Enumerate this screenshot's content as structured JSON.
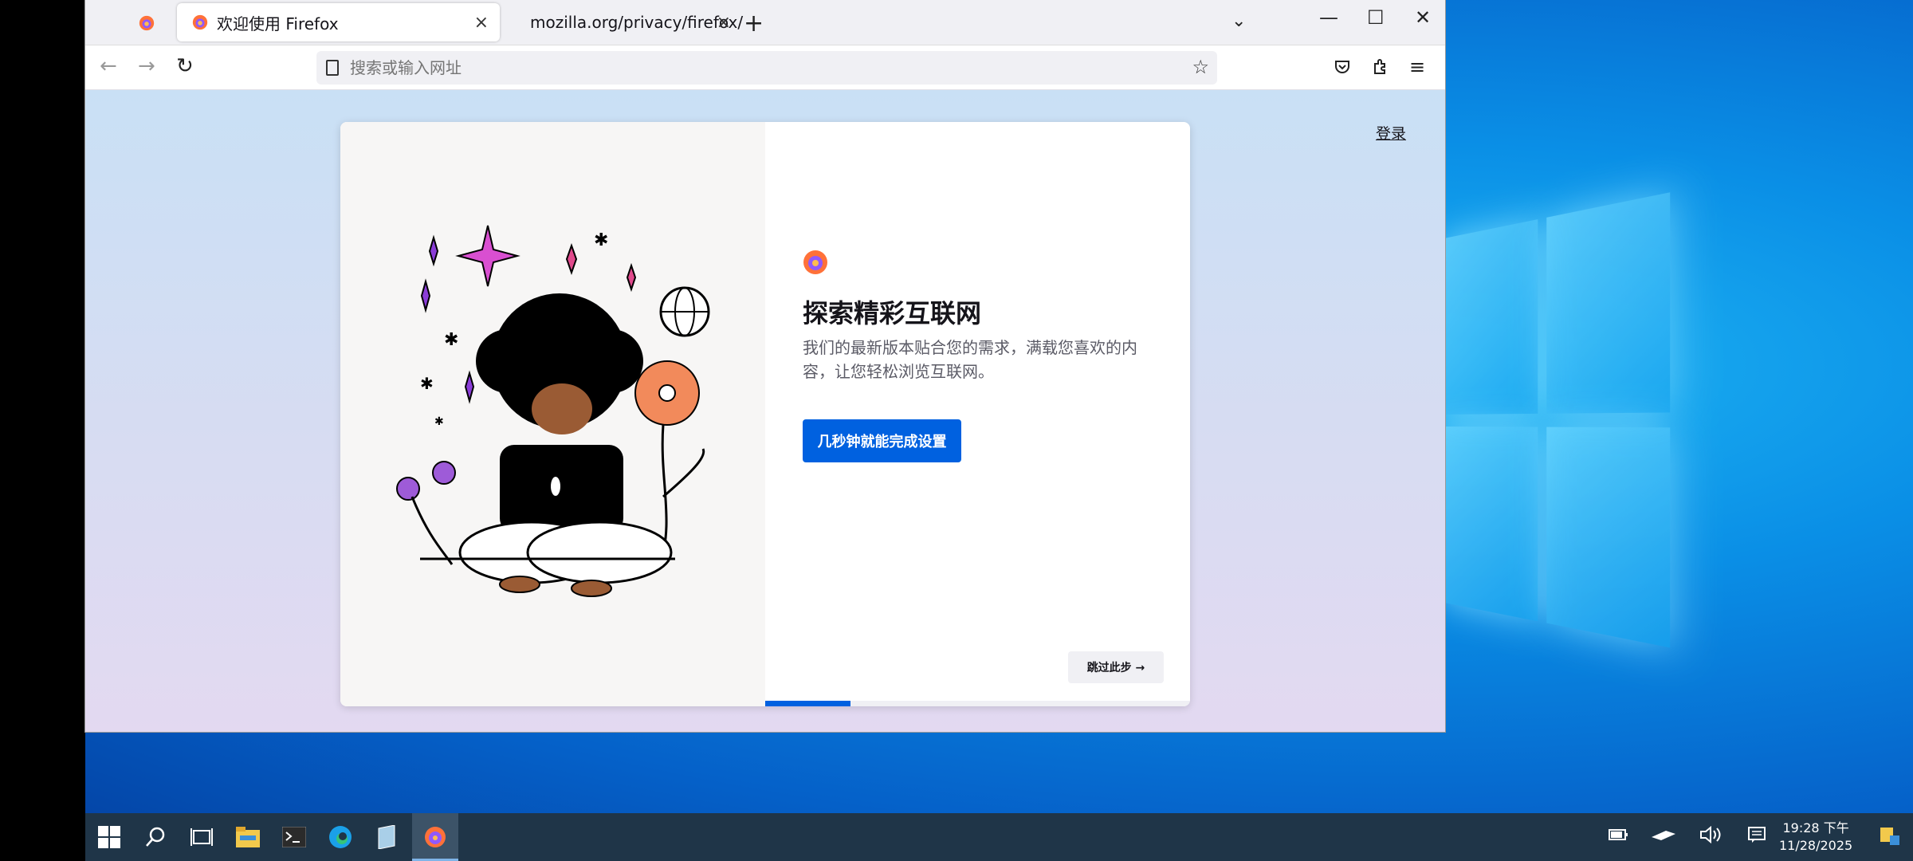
{
  "browser": {
    "tabs": [
      {
        "label": "欢迎使用 Firefox",
        "close": "×"
      },
      {
        "label": "mozilla.org/privacy/firefox/",
        "close": "×"
      }
    ],
    "new_tab": "+",
    "tab_list": "⌄",
    "window_controls": {
      "minimize": "—",
      "maximize": "☐",
      "close": "✕"
    }
  },
  "navbar": {
    "back": "←",
    "forward": "→",
    "reload": "↻",
    "url_placeholder": "搜索或输入网址",
    "bookmark_star": "☆",
    "menu": "≡"
  },
  "page": {
    "signin": "登录",
    "headline": "探索精彩互联网",
    "subtext": "我们的最新版本贴合您的需求，满载您喜欢的内容，让您轻松浏览互联网。",
    "primary_button": "几秒钟就能完成设置",
    "skip_button": "跳过此步 →",
    "progress": 0.2
  },
  "taskbar": {
    "clock_time": "19:28 下午",
    "clock_date": "11/28/2025"
  },
  "colors": {
    "accent": "#0061e0",
    "tab_bg": "#f0f0f4",
    "taskbar": "#1f3548"
  }
}
